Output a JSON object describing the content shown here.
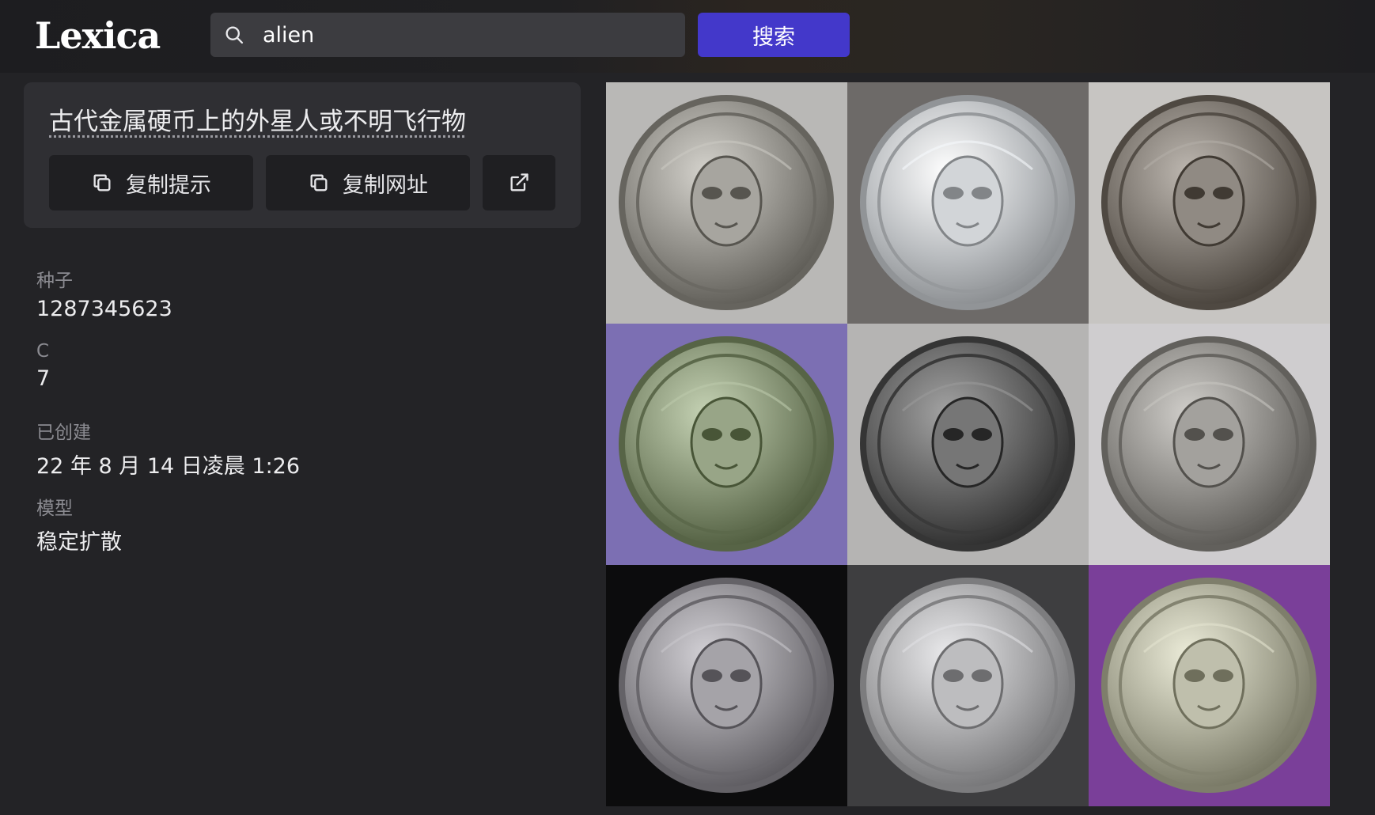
{
  "header": {
    "logo": "Lexica",
    "search": {
      "value": "alien"
    },
    "search_button_label": "搜索"
  },
  "prompt": {
    "text": "古代金属硬币上的外星人或不明飞行物",
    "copy_prompt_label": "复制提示",
    "copy_url_label": "复制网址"
  },
  "meta": {
    "seed_label": "种子",
    "seed_value": "1287345623",
    "c_label": "C",
    "c_value": "7",
    "created_label": "已创建",
    "created_value": "22 年 8 月 14 日凌晨 1:26",
    "model_label": "模型",
    "model_value": "稳定扩散"
  },
  "grid": {
    "images": [
      {
        "icon": "coin-alien-helmet-icon",
        "bg": "#b9b8b6",
        "coin": "#8e8c86"
      },
      {
        "icon": "coin-warriors-icon",
        "bg": "#6d6a68",
        "coin": "#b9bcbf"
      },
      {
        "icon": "coin-symbols-icon",
        "bg": "#c7c5c2",
        "coin": "#77716a"
      },
      {
        "icon": "coin-alien-hat-icon",
        "bg": "#7c6fb3",
        "coin": "#7f8c6e"
      },
      {
        "icon": "coin-alien-mask-icon",
        "bg": "#b5b4b3",
        "coin": "#5d5d5d"
      },
      {
        "icon": "coin-alien-figure-icon",
        "bg": "#cfcdcf",
        "coin": "#8a8884"
      },
      {
        "icon": "coin-starfish-icon",
        "bg": "#0c0c0d",
        "coin": "#8c8a8f"
      },
      {
        "icon": "coin-alien-face-icon",
        "bg": "#3e3e40",
        "coin": "#a4a4a6"
      },
      {
        "icon": "coin-alien-skull-icon",
        "bg": "#7a3f99",
        "coin": "#a6a693"
      }
    ]
  }
}
